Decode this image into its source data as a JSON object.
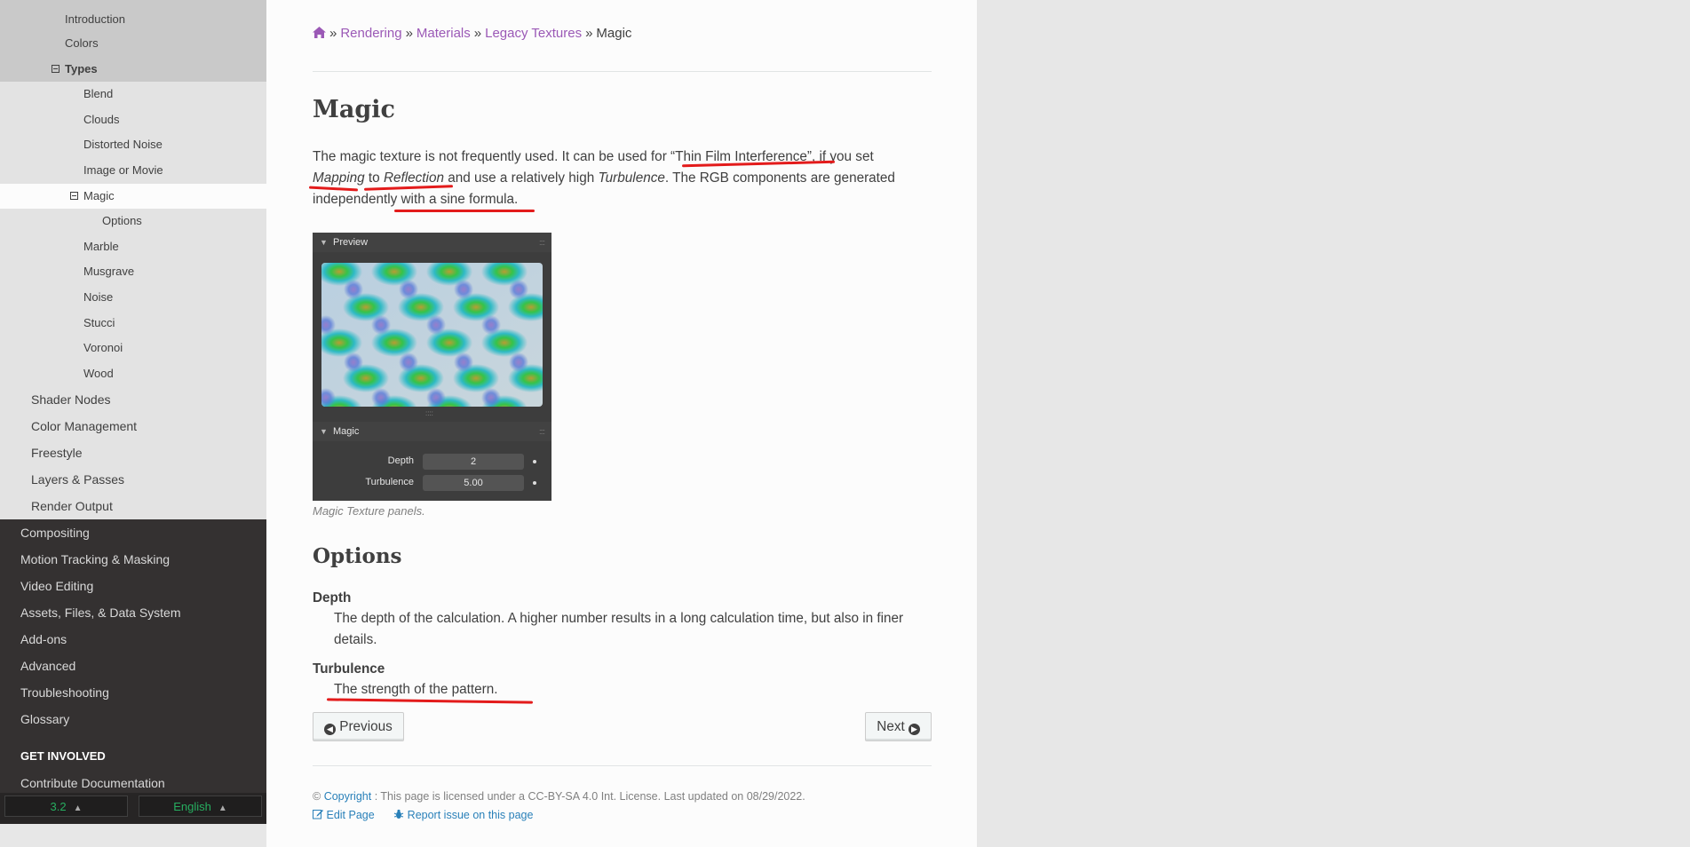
{
  "sidebar": {
    "grey_items": [
      {
        "label": "Introduction"
      },
      {
        "label": "Colors"
      },
      {
        "label": "Types"
      }
    ],
    "types_children": [
      "Blend",
      "Clouds",
      "Distorted Noise",
      "Image or Movie"
    ],
    "current": "Magic",
    "current_child": "Options",
    "after_current": [
      "Marble",
      "Musgrave",
      "Noise",
      "Stucci",
      "Voronoi",
      "Wood"
    ],
    "rendering_items": [
      "Shader Nodes",
      "Color Management",
      "Freestyle",
      "Layers & Passes",
      "Render Output"
    ],
    "dark_items": [
      "Compositing",
      "Motion Tracking & Masking",
      "Video Editing",
      "Assets, Files, & Data System",
      "Add-ons",
      "Advanced",
      "Troubleshooting",
      "Glossary"
    ],
    "caption": "GET INVOLVED",
    "get_involved_items": [
      "Contribute Documentation"
    ]
  },
  "version_bar": {
    "version": "3.2",
    "language": "English"
  },
  "breadcrumb": {
    "items": [
      "Rendering",
      "Materials",
      "Legacy Textures"
    ],
    "current": "Magic"
  },
  "page": {
    "title": "Magic",
    "intro_1": "The magic texture is not frequently used. It can be used for “Thin Film Interference”, if you set",
    "intro_2a": "Mapping",
    "intro_2b": " to ",
    "intro_2c": "Reflection",
    "intro_2d": " and use a relatively high ",
    "intro_2e": "Turbulence",
    "intro_2f": ". The RGB components are generated",
    "intro_3": "independently with a sine formula.",
    "figure_caption": "Magic Texture panels."
  },
  "panel": {
    "preview_label": "Preview",
    "magic_label": "Magic",
    "depth_label": "Depth",
    "depth_value": "2",
    "turbulence_label": "Turbulence",
    "turbulence_value": "5.00"
  },
  "options": {
    "heading": "Options",
    "depth_term": "Depth",
    "depth_desc_1": "The depth of the calculation. A higher number results in a long calculation time, but also in finer",
    "depth_desc_2": "details.",
    "turb_term": "Turbulence",
    "turb_desc": "The strength of the pattern."
  },
  "nav": {
    "previous": "Previous",
    "next": "Next"
  },
  "footer": {
    "copyright_symbol": "©",
    "copyright_link": "Copyright",
    "license_text": ": This page is licensed under a CC-BY-SA 4.0 Int. License. Last updated on 08/29/2022.",
    "edit_page": "Edit Page",
    "report_issue": "Report issue on this page"
  },
  "colors": {
    "link": "#9b59b6",
    "footer_link": "#2980b9",
    "annotation": "#e31b1b",
    "version_green": "#27ae60"
  }
}
